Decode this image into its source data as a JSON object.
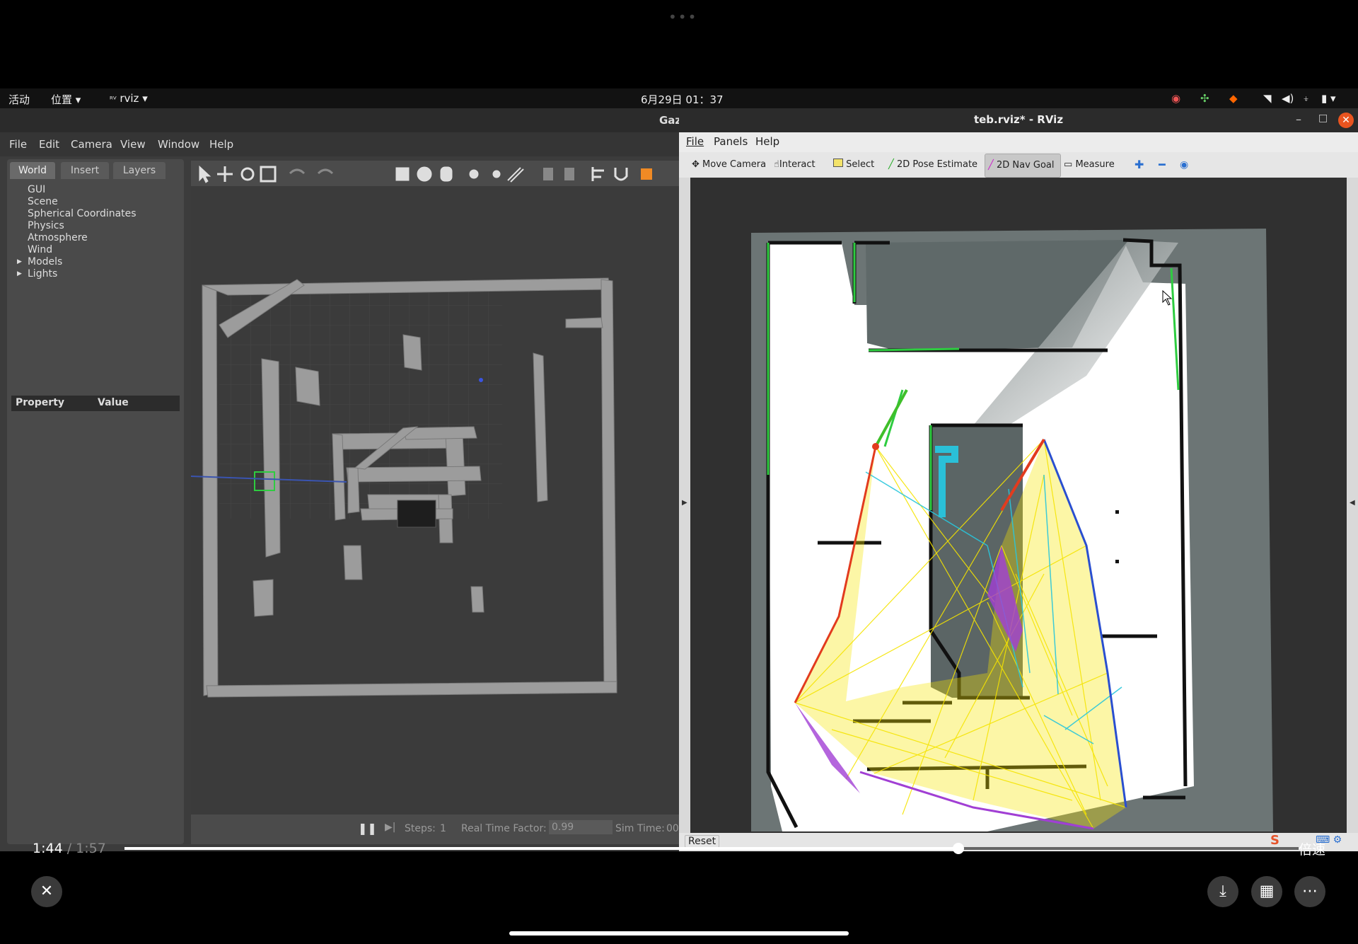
{
  "ubuntu_bar": {
    "activities": "活动",
    "places": "位置",
    "app_menu": "rviz",
    "datetime": "6月29日 01：37"
  },
  "gazebo": {
    "title": "Gaz",
    "menu": [
      "File",
      "Edit",
      "Camera",
      "View",
      "Window",
      "Help"
    ],
    "tabs": [
      "World",
      "Insert",
      "Layers"
    ],
    "tree": [
      "GUI",
      "Scene",
      "Spherical Coordinates",
      "Physics",
      "Atmosphere",
      "Wind",
      "Models",
      "Lights"
    ],
    "property_header": {
      "property": "Property",
      "value": "Value"
    },
    "bottom": {
      "steps_label": "Steps:",
      "steps_value": "1",
      "rtf_label": "Real Time Factor:",
      "rtf_value": "0.99",
      "simtime_label": "Sim Time:",
      "simtime_value": "00"
    }
  },
  "rviz": {
    "title": "teb.rviz* - RViz",
    "menu": [
      "File",
      "Panels",
      "Help"
    ],
    "tools": [
      "Move Camera",
      "Interact",
      "Select",
      "2D Pose Estimate",
      "2D Nav Goal",
      "Measure"
    ],
    "active_tool": "2D Nav Goal",
    "reset_label": "Reset"
  },
  "video": {
    "current_time": "1:44",
    "separator": "/",
    "total_time": "1:57",
    "progress": 0.71,
    "speed_label": "倍速"
  },
  "colors": {
    "path_yellow": "#f5e400",
    "path_cyan": "#29c6dc",
    "path_purple": "#a13fd4",
    "path_red": "#e23b1e",
    "path_green": "#3fbf2a",
    "active_tool_bg": "#c8c8c8"
  }
}
